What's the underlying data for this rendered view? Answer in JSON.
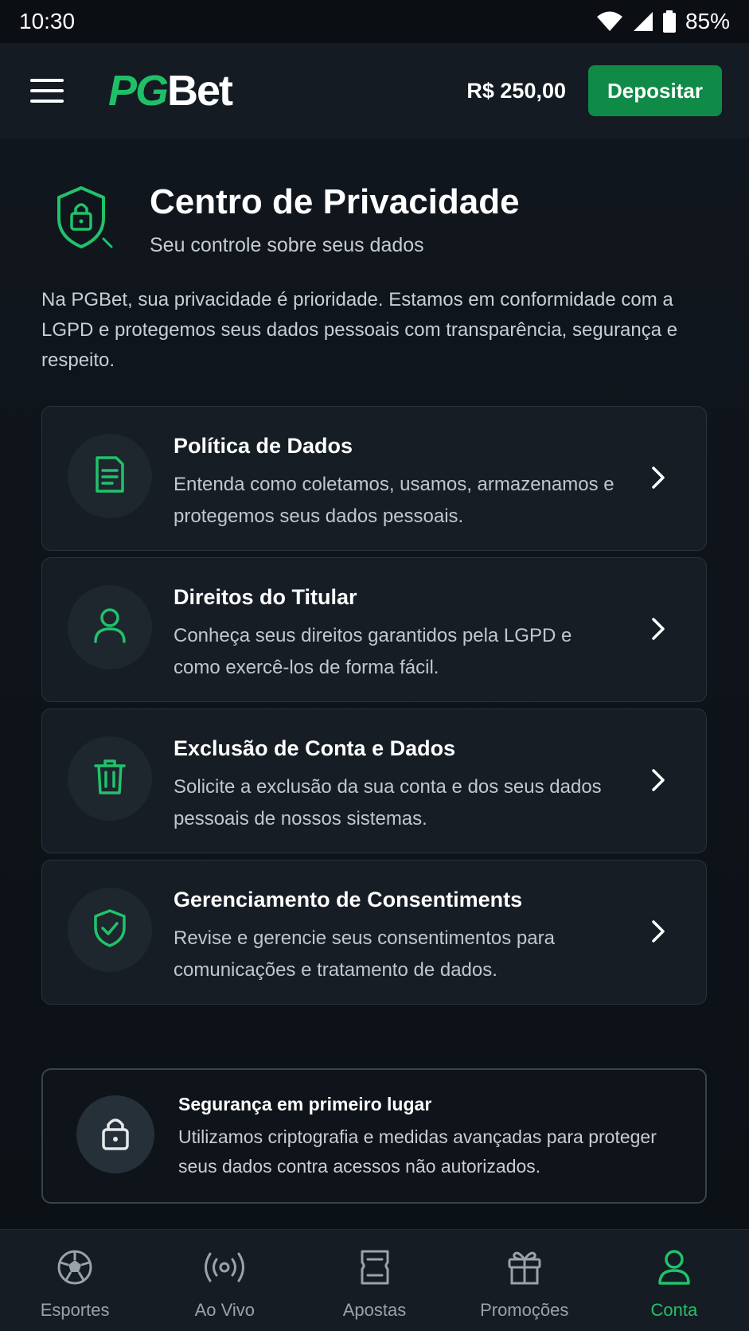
{
  "status_bar": {
    "time": "10:30",
    "battery": "85%",
    "icons": [
      "wifi-icon",
      "signal-icon",
      "battery-icon"
    ]
  },
  "header": {
    "logo_pg": "PG",
    "logo_bet": "Bet",
    "balance": "R$ 250,00",
    "deposit_label": "Depositar"
  },
  "page": {
    "title": "Centro de Privacidade",
    "subtitle": "Seu controle sobre seus dados",
    "intro": "Na PGBet, sua privacidade é prioridade. Estamos em conformidade com a LGPD e protegemos seus dados pessoais com transparência, segurança e respeito.",
    "icon": "shield-lock-icon"
  },
  "cards": [
    {
      "title": "Política de Dados",
      "description": "Entenda como coletamos, usamos, armazenamos e protegemos seus dados pessoais.",
      "icon": "document-icon"
    },
    {
      "title": "Direitos do Titular",
      "description": "Conheça seus direitos garantidos pela LGPD e como exercê-los de forma fácil.",
      "icon": "user-icon"
    },
    {
      "title": "Exclusão de Conta e Dados",
      "description": "Solicite a exclusão da sua conta e dos seus dados pessoais de nossos sistemas.",
      "icon": "trash-icon"
    },
    {
      "title": "Gerenciamento de Consentiments",
      "description": "Revise e gerencie seus consentimentos para comunicações e tratamento de dados.",
      "icon": "shield-check-icon"
    }
  ],
  "security": {
    "title": "Segurança em primeiro lugar",
    "description": "Utilizamos criptografia e medidas avançadas para proteger seus dados contra acessos não autorizados.",
    "icon": "lock-icon"
  },
  "nav": [
    {
      "label": "Esportes",
      "icon": "soccer-ball-icon",
      "active": false
    },
    {
      "label": "Ao Vivo",
      "icon": "live-broadcast-icon",
      "active": false
    },
    {
      "label": "Apostas",
      "icon": "ticket-icon",
      "active": false
    },
    {
      "label": "Promoções",
      "icon": "gift-icon",
      "active": false
    },
    {
      "label": "Conta",
      "icon": "user-icon",
      "active": true
    }
  ],
  "colors": {
    "accent": "#21c26b",
    "deposit": "#0f8a47",
    "background": "#0f141a",
    "card": "#161d24"
  }
}
